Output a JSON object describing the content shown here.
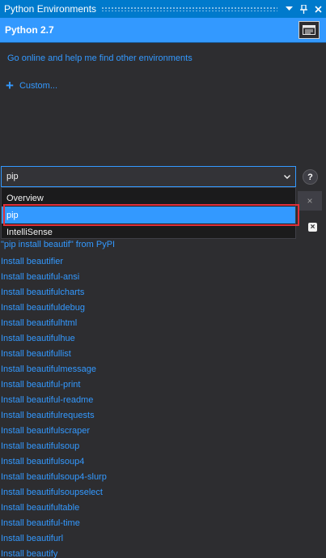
{
  "window": {
    "title": "Python Environments",
    "dropdown_icon": "chevron-down-icon",
    "pin_icon": "pin-icon",
    "close_icon": "close-icon",
    "accent_color": "#007acc"
  },
  "environment": {
    "name": "Python 2.7",
    "console_icon": "interactive-window-icon"
  },
  "links": {
    "find_other": "Go online and help me find other environments",
    "custom": "Custom..."
  },
  "view_select": {
    "selected": "pip",
    "options": [
      "Overview",
      "pip",
      "IntelliSense"
    ],
    "help_label": "?"
  },
  "search": {
    "clear_label": "×"
  },
  "pypi": {
    "install_query": "\"pip install beautif\" from PyPI"
  },
  "results": [
    "Install beautifier",
    "Install beautiful-ansi",
    "Install beautifulcharts",
    "Install beautifuldebug",
    "Install beautifulhtml",
    "Install beautifulhue",
    "Install beautifullist",
    "Install beautifulmessage",
    "Install beautiful-print",
    "Install beautiful-readme",
    "Install beautifulrequests",
    "Install beautifulscraper",
    "Install beautifulsoup",
    "Install beautifulsoup4",
    "Install beautifulsoup4-slurp",
    "Install beautifulsoupselect",
    "Install beautifultable",
    "Install beautiful-time",
    "Install beautifurl",
    "Install beautify"
  ]
}
